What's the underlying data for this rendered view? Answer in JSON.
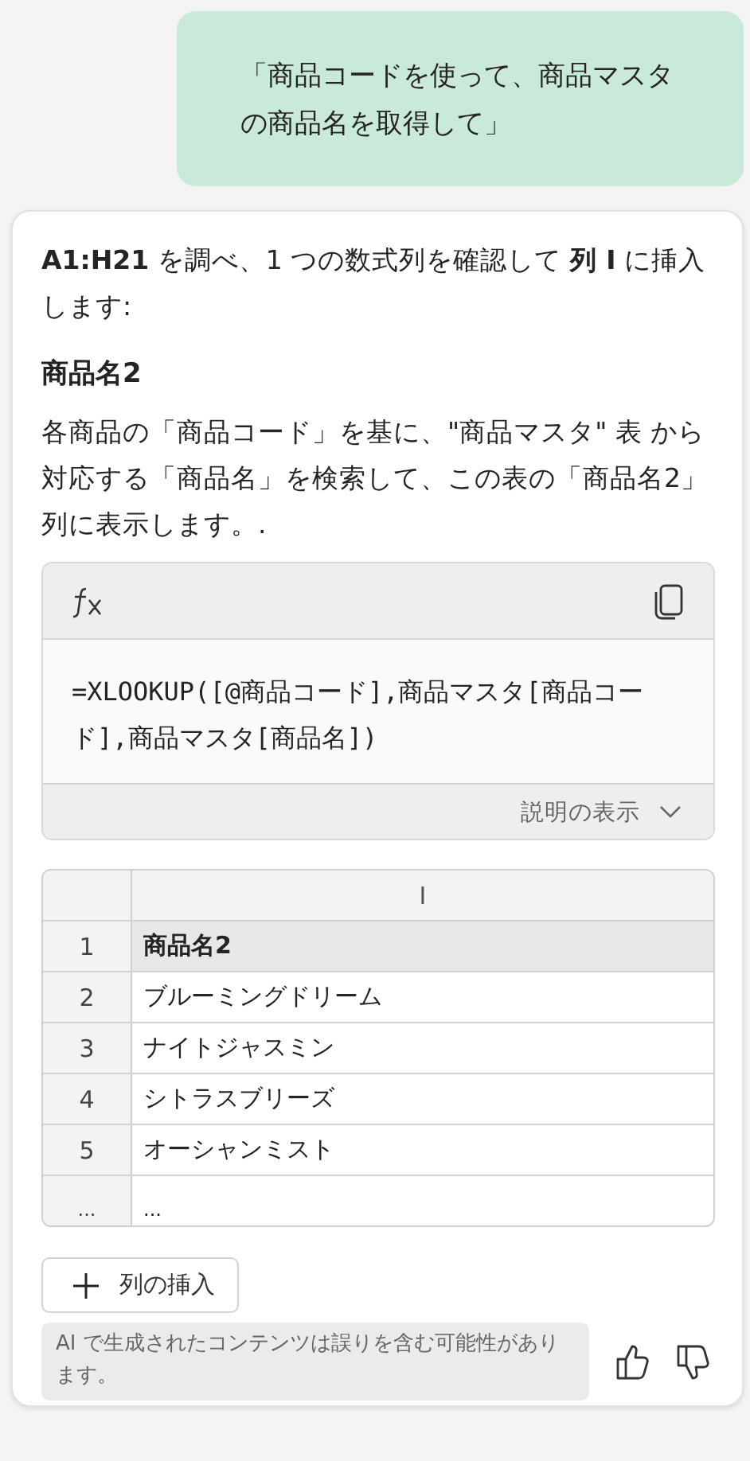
{
  "user_message": "「商品コードを使って、商品マスタの商品名を取得して」",
  "response": {
    "intro": "**A1:H21** を調べ、1 つの数式列を確認して **列 I** に挿入します:",
    "heading": "商品名2",
    "description": "各商品の「商品コード」を基に、\"商品マスタ\" 表 から対応する「商品名」を検索して、この表の「商品名2」列に表示します。.",
    "formula": {
      "code": "=XLOOKUP([@商品コード],商品マスタ[商品コード],商品マスタ[商品名])",
      "explain_label": "説明の表示"
    },
    "table": {
      "column_header": "I",
      "rows": [
        {
          "number": "1",
          "value": "商品名2",
          "kind": "header"
        },
        {
          "number": "2",
          "value": "ブルーミングドリーム",
          "kind": "data"
        },
        {
          "number": "3",
          "value": "ナイトジャスミン",
          "kind": "data"
        },
        {
          "number": "4",
          "value": "シトラスブリーズ",
          "kind": "data"
        },
        {
          "number": "5",
          "value": "オーシャンミスト",
          "kind": "data"
        },
        {
          "number": "...",
          "value": "...",
          "kind": "more"
        }
      ]
    },
    "insert_button": "列の挿入",
    "disclaimer": "AI で生成されたコンテンツは誤りを含む可能性があります。"
  }
}
